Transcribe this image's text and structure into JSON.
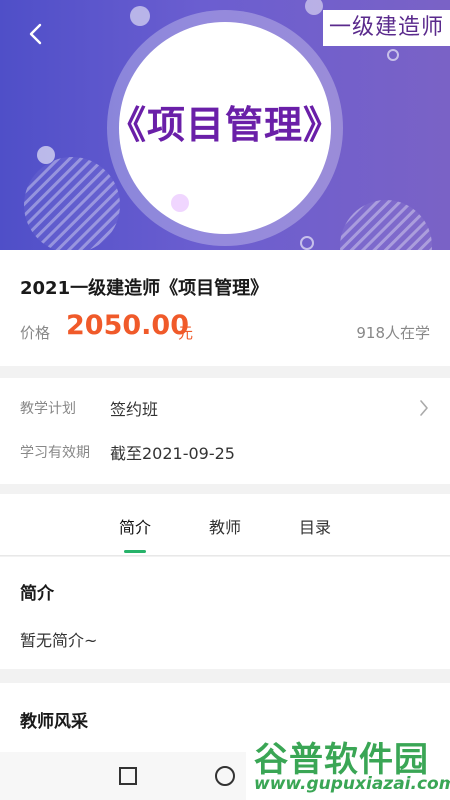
{
  "banner": {
    "corner_tag": "一级建造师",
    "title": "《项目管理》"
  },
  "course": {
    "title": "2021一级建造师《项目管理》",
    "price_label": "价格",
    "price_value": "2050.00",
    "price_unit": "元",
    "learners": "918人在学"
  },
  "plan": {
    "rows": [
      {
        "label": "教学计划",
        "value": "签约班"
      },
      {
        "label": "学习有效期",
        "value": "截至2021-09-25"
      }
    ]
  },
  "tabs": [
    {
      "label": "简介"
    },
    {
      "label": "教师"
    },
    {
      "label": "目录"
    }
  ],
  "intro": {
    "heading": "简介",
    "text": "暂无简介~"
  },
  "teacher": {
    "heading": "教师风采"
  },
  "watermark": {
    "title": "谷普软件园",
    "url": "www.gupuxiazai.com"
  },
  "colors": {
    "accent": "#27b36a",
    "price": "#f05a2a",
    "banner_start": "#4f4fc8",
    "banner_end": "#7a62c6"
  },
  "icons": {
    "back": "back-arrow-icon",
    "chevron": "chevron-right-icon",
    "recent_apps": "square-icon",
    "home": "circle-icon"
  }
}
